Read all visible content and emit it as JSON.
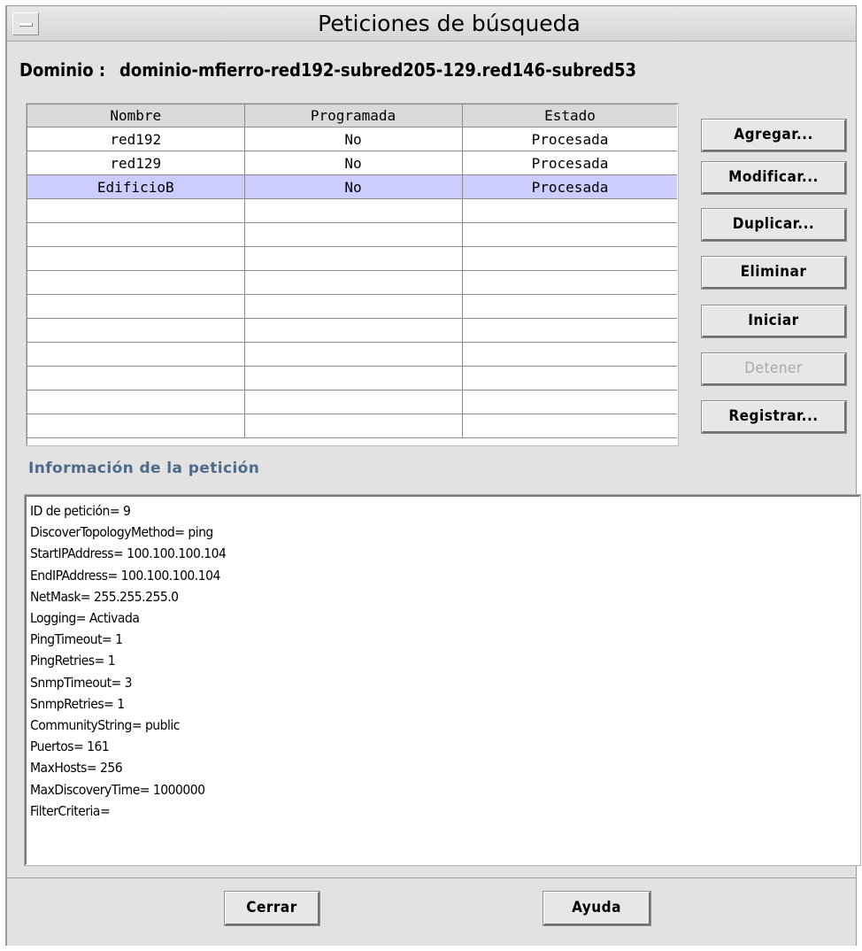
{
  "window": {
    "title": "Peticiones de búsqueda"
  },
  "domain": {
    "label": "Dominio :",
    "value": "dominio-mfierro-red192-subred205-129.red146-subred53"
  },
  "table": {
    "columns": [
      "Nombre",
      "Programada",
      "Estado"
    ],
    "rows": [
      [
        "red192",
        "No",
        "Procesada"
      ],
      [
        "red129",
        "No",
        "Procesada"
      ],
      [
        "EdificioB",
        "No",
        "Procesada"
      ],
      [
        "",
        "",
        ""
      ],
      [
        "",
        "",
        ""
      ],
      [
        "",
        "",
        ""
      ],
      [
        "",
        "",
        ""
      ],
      [
        "",
        "",
        ""
      ],
      [
        "",
        "",
        ""
      ],
      [
        "",
        "",
        ""
      ],
      [
        "",
        "",
        ""
      ],
      [
        "",
        "",
        ""
      ],
      [
        "",
        "",
        ""
      ]
    ],
    "selected_row": 2
  },
  "actions": {
    "add": "Agregar...",
    "modify": "Modificar...",
    "duplicate": "Duplicar...",
    "delete": "Eliminar",
    "start": "Iniciar",
    "stop": "Detener",
    "log": "Registrar..."
  },
  "info": {
    "label": "Información de la petición",
    "lines": [
      "ID de petición= 9",
      "DiscoverTopologyMethod= ping",
      "StartIPAddress= 100.100.100.104",
      "EndIPAddress= 100.100.100.104",
      "NetMask= 255.255.255.0",
      "Logging= Activada",
      "PingTimeout= 1",
      "PingRetries= 1",
      "SnmpTimeout= 3",
      "SnmpRetries= 1",
      "CommunityString= public",
      "Puertos= 161",
      "MaxHosts= 256",
      "MaxDiscoveryTime= 1000000",
      "FilterCriteria="
    ]
  },
  "footer": {
    "close": "Cerrar",
    "help": "Ayuda"
  },
  "colors": {
    "selected_row": "#ccccff",
    "info_label": "#4f6a8a",
    "disabled_text": "#a8a8a8"
  }
}
